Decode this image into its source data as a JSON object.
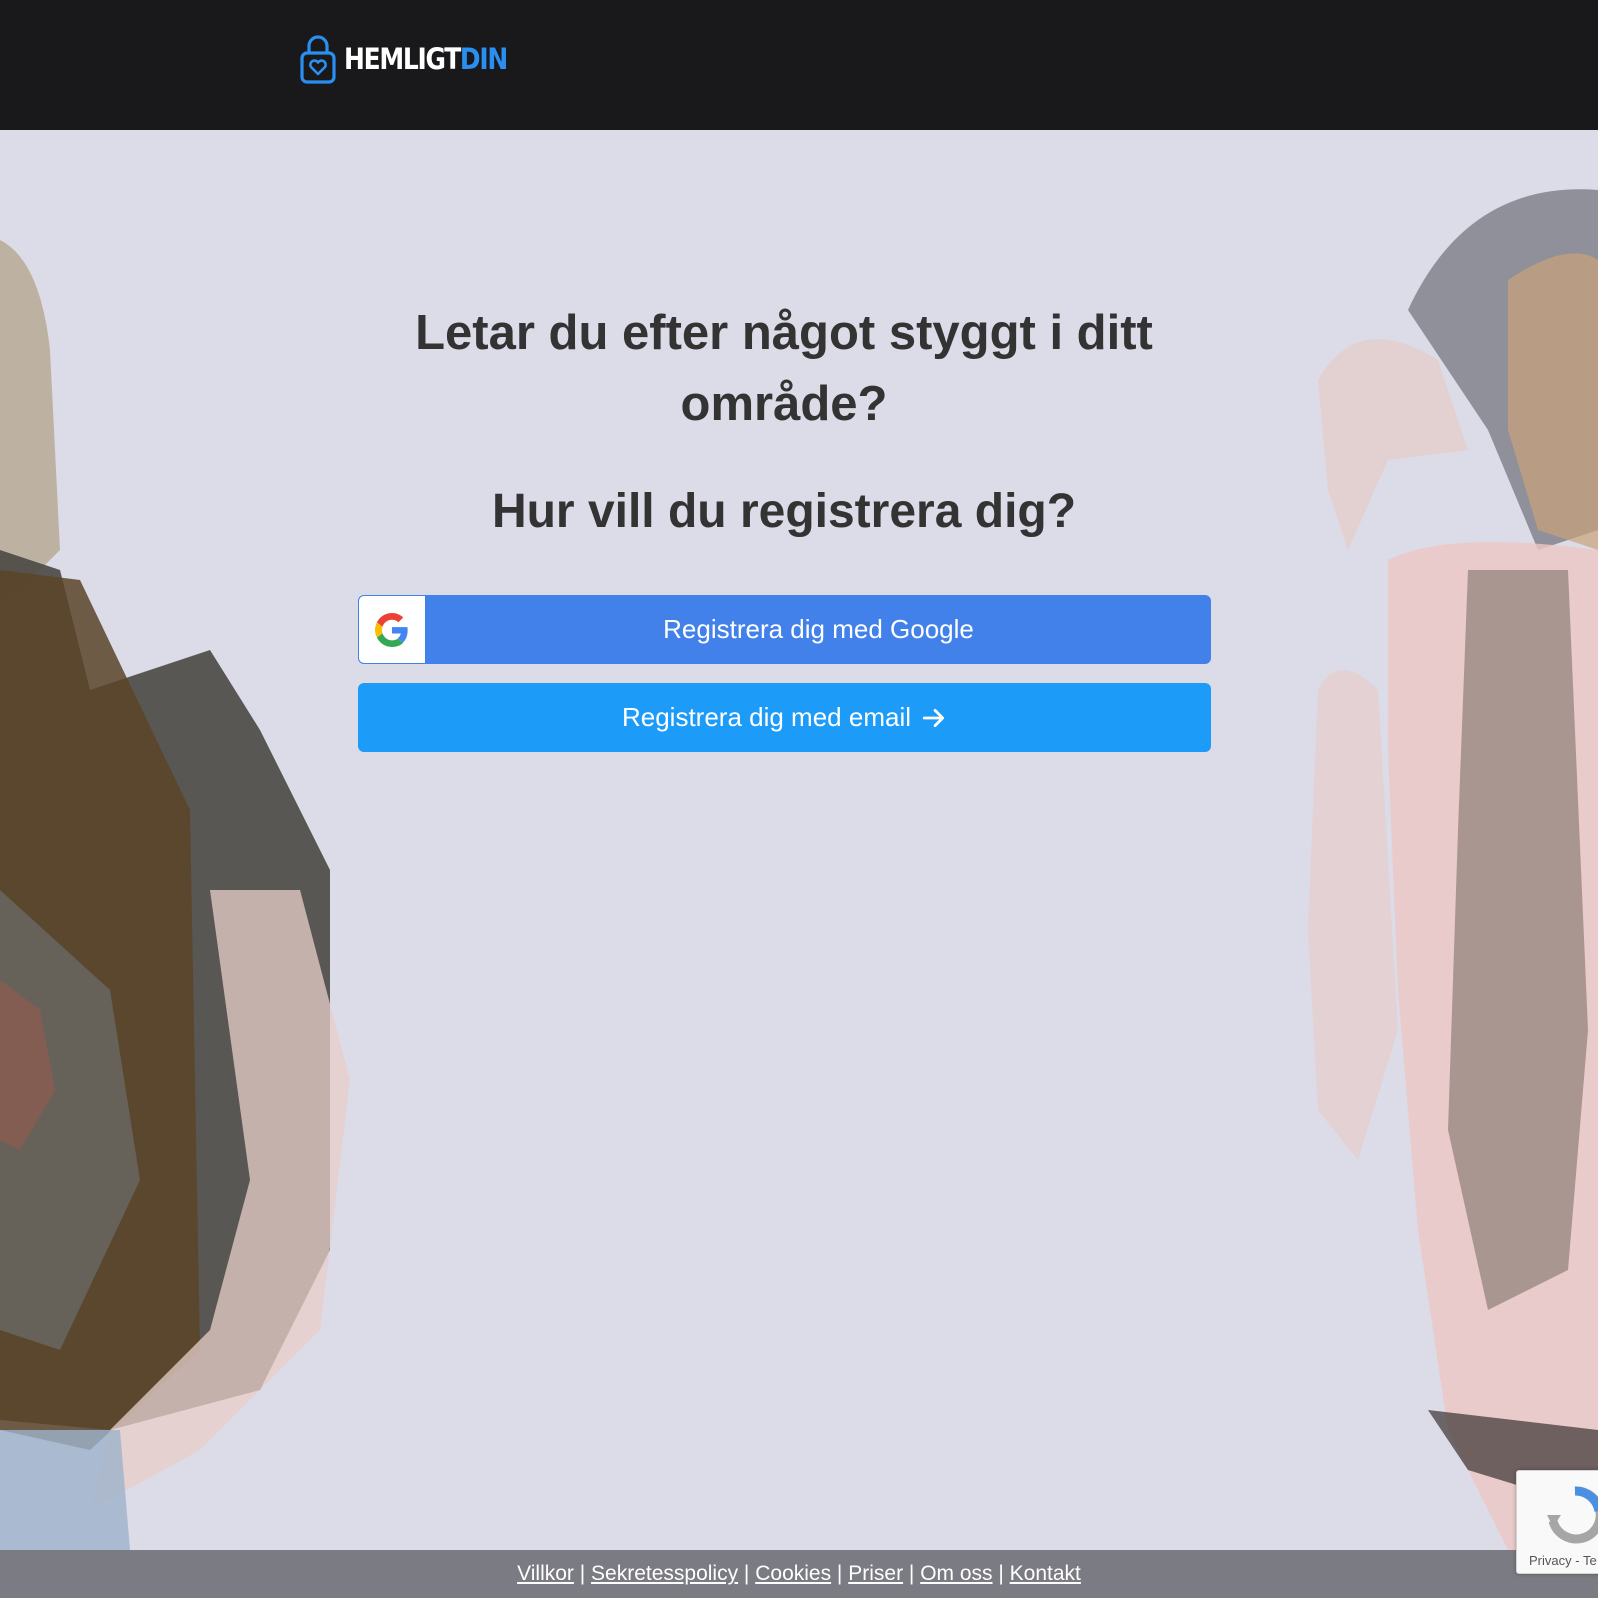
{
  "header": {
    "logo_part1": "HEMLIGT",
    "logo_part2": "DIN",
    "logo_icon": "lock-heart-icon",
    "accent_color": "#2a8ff0",
    "background_color": "#19191b"
  },
  "main": {
    "headline": "Letar du efter något styggt i ditt område?",
    "subheadline": "Hur vill du registrera dig?",
    "google_button_label": "Registrera dig med Google",
    "email_button_label": "Registrera dig med email",
    "google_button_color": "#4280ea",
    "email_button_color": "#1c9bf8"
  },
  "footer": {
    "links": [
      "Villkor",
      "Sekretesspolicy",
      "Cookies",
      "Priser",
      "Om oss",
      "Kontakt"
    ]
  },
  "recaptcha": {
    "privacy_label": "Privacy",
    "separator": "-",
    "terms_label": "Te"
  }
}
